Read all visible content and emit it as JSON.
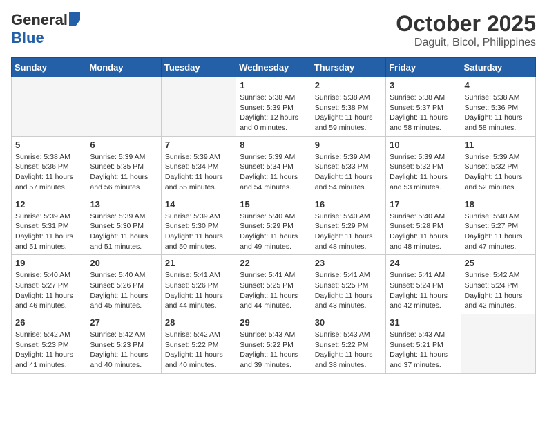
{
  "header": {
    "logo_general": "General",
    "logo_blue": "Blue",
    "month_year": "October 2025",
    "location": "Daguit, Bicol, Philippines"
  },
  "days_of_week": [
    "Sunday",
    "Monday",
    "Tuesday",
    "Wednesday",
    "Thursday",
    "Friday",
    "Saturday"
  ],
  "weeks": [
    [
      {
        "day": "",
        "info": ""
      },
      {
        "day": "",
        "info": ""
      },
      {
        "day": "",
        "info": ""
      },
      {
        "day": "1",
        "sunrise": "Sunrise: 5:38 AM",
        "sunset": "Sunset: 5:39 PM",
        "daylight": "Daylight: 12 hours and 0 minutes."
      },
      {
        "day": "2",
        "sunrise": "Sunrise: 5:38 AM",
        "sunset": "Sunset: 5:38 PM",
        "daylight": "Daylight: 11 hours and 59 minutes."
      },
      {
        "day": "3",
        "sunrise": "Sunrise: 5:38 AM",
        "sunset": "Sunset: 5:37 PM",
        "daylight": "Daylight: 11 hours and 58 minutes."
      },
      {
        "day": "4",
        "sunrise": "Sunrise: 5:38 AM",
        "sunset": "Sunset: 5:36 PM",
        "daylight": "Daylight: 11 hours and 58 minutes."
      }
    ],
    [
      {
        "day": "5",
        "sunrise": "Sunrise: 5:38 AM",
        "sunset": "Sunset: 5:36 PM",
        "daylight": "Daylight: 11 hours and 57 minutes."
      },
      {
        "day": "6",
        "sunrise": "Sunrise: 5:39 AM",
        "sunset": "Sunset: 5:35 PM",
        "daylight": "Daylight: 11 hours and 56 minutes."
      },
      {
        "day": "7",
        "sunrise": "Sunrise: 5:39 AM",
        "sunset": "Sunset: 5:34 PM",
        "daylight": "Daylight: 11 hours and 55 minutes."
      },
      {
        "day": "8",
        "sunrise": "Sunrise: 5:39 AM",
        "sunset": "Sunset: 5:34 PM",
        "daylight": "Daylight: 11 hours and 54 minutes."
      },
      {
        "day": "9",
        "sunrise": "Sunrise: 5:39 AM",
        "sunset": "Sunset: 5:33 PM",
        "daylight": "Daylight: 11 hours and 54 minutes."
      },
      {
        "day": "10",
        "sunrise": "Sunrise: 5:39 AM",
        "sunset": "Sunset: 5:32 PM",
        "daylight": "Daylight: 11 hours and 53 minutes."
      },
      {
        "day": "11",
        "sunrise": "Sunrise: 5:39 AM",
        "sunset": "Sunset: 5:32 PM",
        "daylight": "Daylight: 11 hours and 52 minutes."
      }
    ],
    [
      {
        "day": "12",
        "sunrise": "Sunrise: 5:39 AM",
        "sunset": "Sunset: 5:31 PM",
        "daylight": "Daylight: 11 hours and 51 minutes."
      },
      {
        "day": "13",
        "sunrise": "Sunrise: 5:39 AM",
        "sunset": "Sunset: 5:30 PM",
        "daylight": "Daylight: 11 hours and 51 minutes."
      },
      {
        "day": "14",
        "sunrise": "Sunrise: 5:39 AM",
        "sunset": "Sunset: 5:30 PM",
        "daylight": "Daylight: 11 hours and 50 minutes."
      },
      {
        "day": "15",
        "sunrise": "Sunrise: 5:40 AM",
        "sunset": "Sunset: 5:29 PM",
        "daylight": "Daylight: 11 hours and 49 minutes."
      },
      {
        "day": "16",
        "sunrise": "Sunrise: 5:40 AM",
        "sunset": "Sunset: 5:29 PM",
        "daylight": "Daylight: 11 hours and 48 minutes."
      },
      {
        "day": "17",
        "sunrise": "Sunrise: 5:40 AM",
        "sunset": "Sunset: 5:28 PM",
        "daylight": "Daylight: 11 hours and 48 minutes."
      },
      {
        "day": "18",
        "sunrise": "Sunrise: 5:40 AM",
        "sunset": "Sunset: 5:27 PM",
        "daylight": "Daylight: 11 hours and 47 minutes."
      }
    ],
    [
      {
        "day": "19",
        "sunrise": "Sunrise: 5:40 AM",
        "sunset": "Sunset: 5:27 PM",
        "daylight": "Daylight: 11 hours and 46 minutes."
      },
      {
        "day": "20",
        "sunrise": "Sunrise: 5:40 AM",
        "sunset": "Sunset: 5:26 PM",
        "daylight": "Daylight: 11 hours and 45 minutes."
      },
      {
        "day": "21",
        "sunrise": "Sunrise: 5:41 AM",
        "sunset": "Sunset: 5:26 PM",
        "daylight": "Daylight: 11 hours and 44 minutes."
      },
      {
        "day": "22",
        "sunrise": "Sunrise: 5:41 AM",
        "sunset": "Sunset: 5:25 PM",
        "daylight": "Daylight: 11 hours and 44 minutes."
      },
      {
        "day": "23",
        "sunrise": "Sunrise: 5:41 AM",
        "sunset": "Sunset: 5:25 PM",
        "daylight": "Daylight: 11 hours and 43 minutes."
      },
      {
        "day": "24",
        "sunrise": "Sunrise: 5:41 AM",
        "sunset": "Sunset: 5:24 PM",
        "daylight": "Daylight: 11 hours and 42 minutes."
      },
      {
        "day": "25",
        "sunrise": "Sunrise: 5:42 AM",
        "sunset": "Sunset: 5:24 PM",
        "daylight": "Daylight: 11 hours and 42 minutes."
      }
    ],
    [
      {
        "day": "26",
        "sunrise": "Sunrise: 5:42 AM",
        "sunset": "Sunset: 5:23 PM",
        "daylight": "Daylight: 11 hours and 41 minutes."
      },
      {
        "day": "27",
        "sunrise": "Sunrise: 5:42 AM",
        "sunset": "Sunset: 5:23 PM",
        "daylight": "Daylight: 11 hours and 40 minutes."
      },
      {
        "day": "28",
        "sunrise": "Sunrise: 5:42 AM",
        "sunset": "Sunset: 5:22 PM",
        "daylight": "Daylight: 11 hours and 40 minutes."
      },
      {
        "day": "29",
        "sunrise": "Sunrise: 5:43 AM",
        "sunset": "Sunset: 5:22 PM",
        "daylight": "Daylight: 11 hours and 39 minutes."
      },
      {
        "day": "30",
        "sunrise": "Sunrise: 5:43 AM",
        "sunset": "Sunset: 5:22 PM",
        "daylight": "Daylight: 11 hours and 38 minutes."
      },
      {
        "day": "31",
        "sunrise": "Sunrise: 5:43 AM",
        "sunset": "Sunset: 5:21 PM",
        "daylight": "Daylight: 11 hours and 37 minutes."
      },
      {
        "day": "",
        "info": ""
      }
    ]
  ]
}
